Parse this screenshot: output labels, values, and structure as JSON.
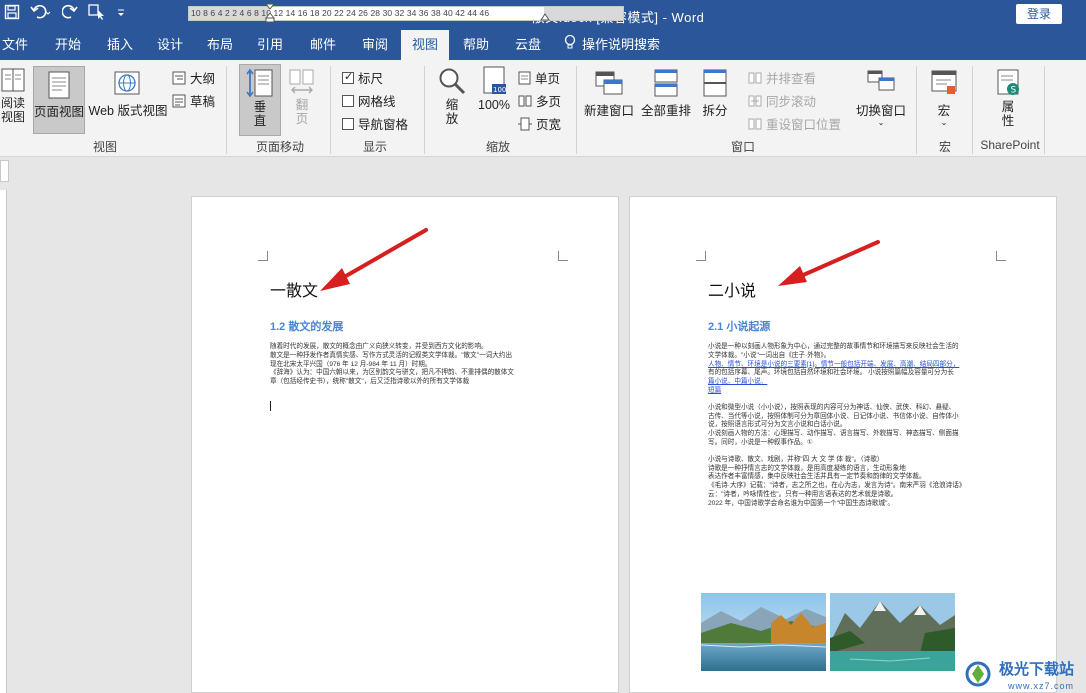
{
  "titlebar": {
    "title": "散文.docx [兼容模式]  -  Word",
    "login_label": "登录",
    "qat_icons": [
      "save-icon",
      "undo-icon",
      "redo-icon",
      "touch-mode-icon",
      "customize-qat-icon"
    ]
  },
  "tabs": [
    "文件",
    "开始",
    "插入",
    "设计",
    "布局",
    "引用",
    "邮件",
    "审阅",
    "视图",
    "帮助",
    "云盘",
    "操作说明搜索"
  ],
  "active_tab": "视图",
  "ribbon": {
    "views": {
      "read_mode": "阅读\n视图",
      "print_layout": "页面视图",
      "web_layout": "Web 版式视图",
      "outline": "大纲",
      "draft": "草稿",
      "group": "视图"
    },
    "page_movement": {
      "vertical": "垂\n直",
      "side_to_side": "翻\n页",
      "group": "页面移动"
    },
    "show": {
      "ruler": "标尺",
      "gridlines": "网格线",
      "nav_pane": "导航窗格",
      "ruler_checked": true,
      "gridlines_checked": false,
      "nav_checked": false,
      "group": "显示"
    },
    "zoom": {
      "zoom": "缩\n放",
      "hundred": "100%",
      "one_page": "单页",
      "multi_page": "多页",
      "page_width": "页宽",
      "group": "缩放"
    },
    "window": {
      "new_window": "新建窗口",
      "arrange_all": "全部重排",
      "split": "拆分",
      "side_by_side": "并排查看",
      "sync_scroll": "同步滚动",
      "reset_pos": "重设窗口位置",
      "switch": "切换窗口",
      "group": "窗口"
    },
    "macros": {
      "label": "宏",
      "group": "宏"
    },
    "sharepoint": {
      "label": "属\n性",
      "group": "SharePoint"
    }
  },
  "ruler_numbers": "10  8  6  4  2         2  4  6  8  10 12 14 16 18 20 22 24 26 28 30 32 34 36 38     40 42 44 46",
  "page1": {
    "heading": "一散文",
    "subheading": "1.2 散文的发展",
    "paragraphs": [
      "随着时代的发展，散文的概念由广义向狭义转变，并受到西方文化的影响。",
      "散文是一种抒发作者真情实感、写作方式灵活的记叙类文学体裁。\"散文\"一词大约出",
      "现在北宋太平兴国（976 年 12 月-984 年 11 月）时期。",
      "《辞海》认为：中国六朝以来，为区别韵文与骈文，把凡不押韵、不重排偶的散体文",
      "章（包括经传史书），统称\"散文\"，后又泛指诗歌以外的所有文学体裁"
    ]
  },
  "page2": {
    "heading": "二小说",
    "subheading": "2.1 小说起源",
    "block1": [
      "小说是一种以刻画人物形象为中心，通过完整的故事情节和环境描写来反映社会生活的",
      "文学体裁。\"小说\"一词出自《庄子·外物》。",
      "人物、情节、环境是小说的三要素[1]。情节一般包括开端、发展、高潮、结局四部分，",
      "有的包括序幕、尾声。环境包括自然环境和社会环境。 小说按照篇幅及容量可分为长",
      "篇小说、中篇小说、",
      "短篇"
    ],
    "block2": [
      "小说和微型小说（小小说），按照表现的内容可分为神话、仙侠、武侠、科幻、悬疑、",
      "古传、当代等小说，按照体制可分为章回体小说、日记体小说、书信体小说、自传体小",
      "说，按照语言形式可分为文言小说和白话小说。",
      "小说刻画人物的方法：心理描写、动作描写、语言描写、外貌描写、神态描写、侧面描",
      "写。同时，小说是一种叙事作品。①"
    ],
    "block3": [
      "小说与诗歌、散文、戏剧，并称\"四 大 文 学 体 裁\"。（诗歌）",
      "诗歌是一种抒情言志的文学体裁，是用高度凝练的语言，生动形象地",
      "表达作者丰富情感，集中反映社会生活并具有一定节奏和韵律的文学体裁。",
      "《毛诗·大序》记载：\"诗者，志之所之也，在心为志，发言为诗\"。南宋严羽《沧浪诗话》",
      "云：\"诗者，吟咏情性也\"。只有一种用言语表达的艺术就是诗歌。",
      "2022 年，中国诗歌学会命名谁为中国第一个\"中国生态诗歌城\"。"
    ],
    "image1_alt": "湖光秋色风景图",
    "image2_alt": "山川湖泊风景图"
  },
  "watermark": {
    "name": "极光下载站",
    "url": "www.xz7.com"
  }
}
